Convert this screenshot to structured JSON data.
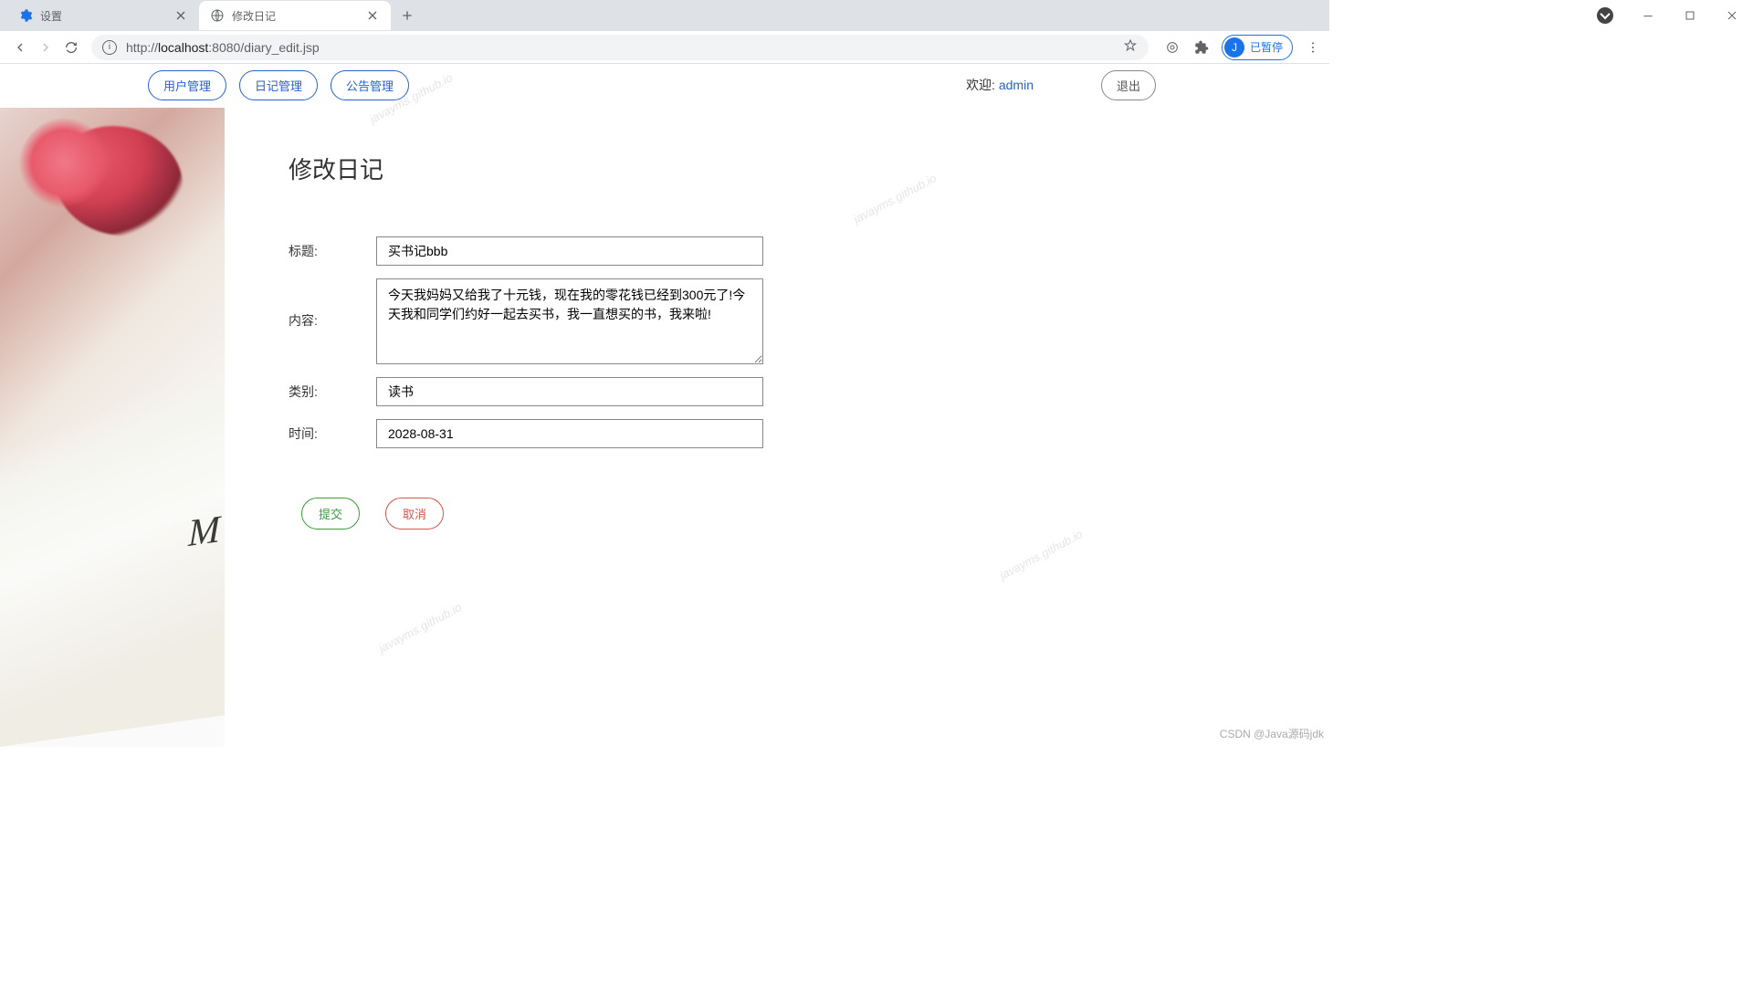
{
  "browser": {
    "tabs": [
      {
        "title": "设置",
        "active": false
      },
      {
        "title": "修改日记",
        "active": true
      }
    ],
    "url_proto": "http://",
    "url_host": "localhost",
    "url_port_path": ":8080/diary_edit.jsp",
    "profile_initial": "J",
    "profile_status": "已暂停"
  },
  "nav": {
    "items": [
      "用户管理",
      "日记管理",
      "公告管理"
    ],
    "welcome_prefix": "欢迎:  ",
    "username": "admin",
    "logout": "退出"
  },
  "form": {
    "title": "修改日记",
    "labels": {
      "title": "标题:",
      "content": "内容:",
      "category": "类别:",
      "date": "时间:"
    },
    "values": {
      "title": "买书记bbb",
      "content": "今天我妈妈又给我了十元钱，现在我的零花钱已经到300元了!今天我和同学们约好一起去买书，我一直想买的书，我来啦!",
      "category": "读书",
      "date": "2028-08-31"
    },
    "buttons": {
      "submit": "提交",
      "cancel": "取消"
    }
  },
  "watermark": "javayms.github.io",
  "credit": "CSDN @Java源码jdk"
}
